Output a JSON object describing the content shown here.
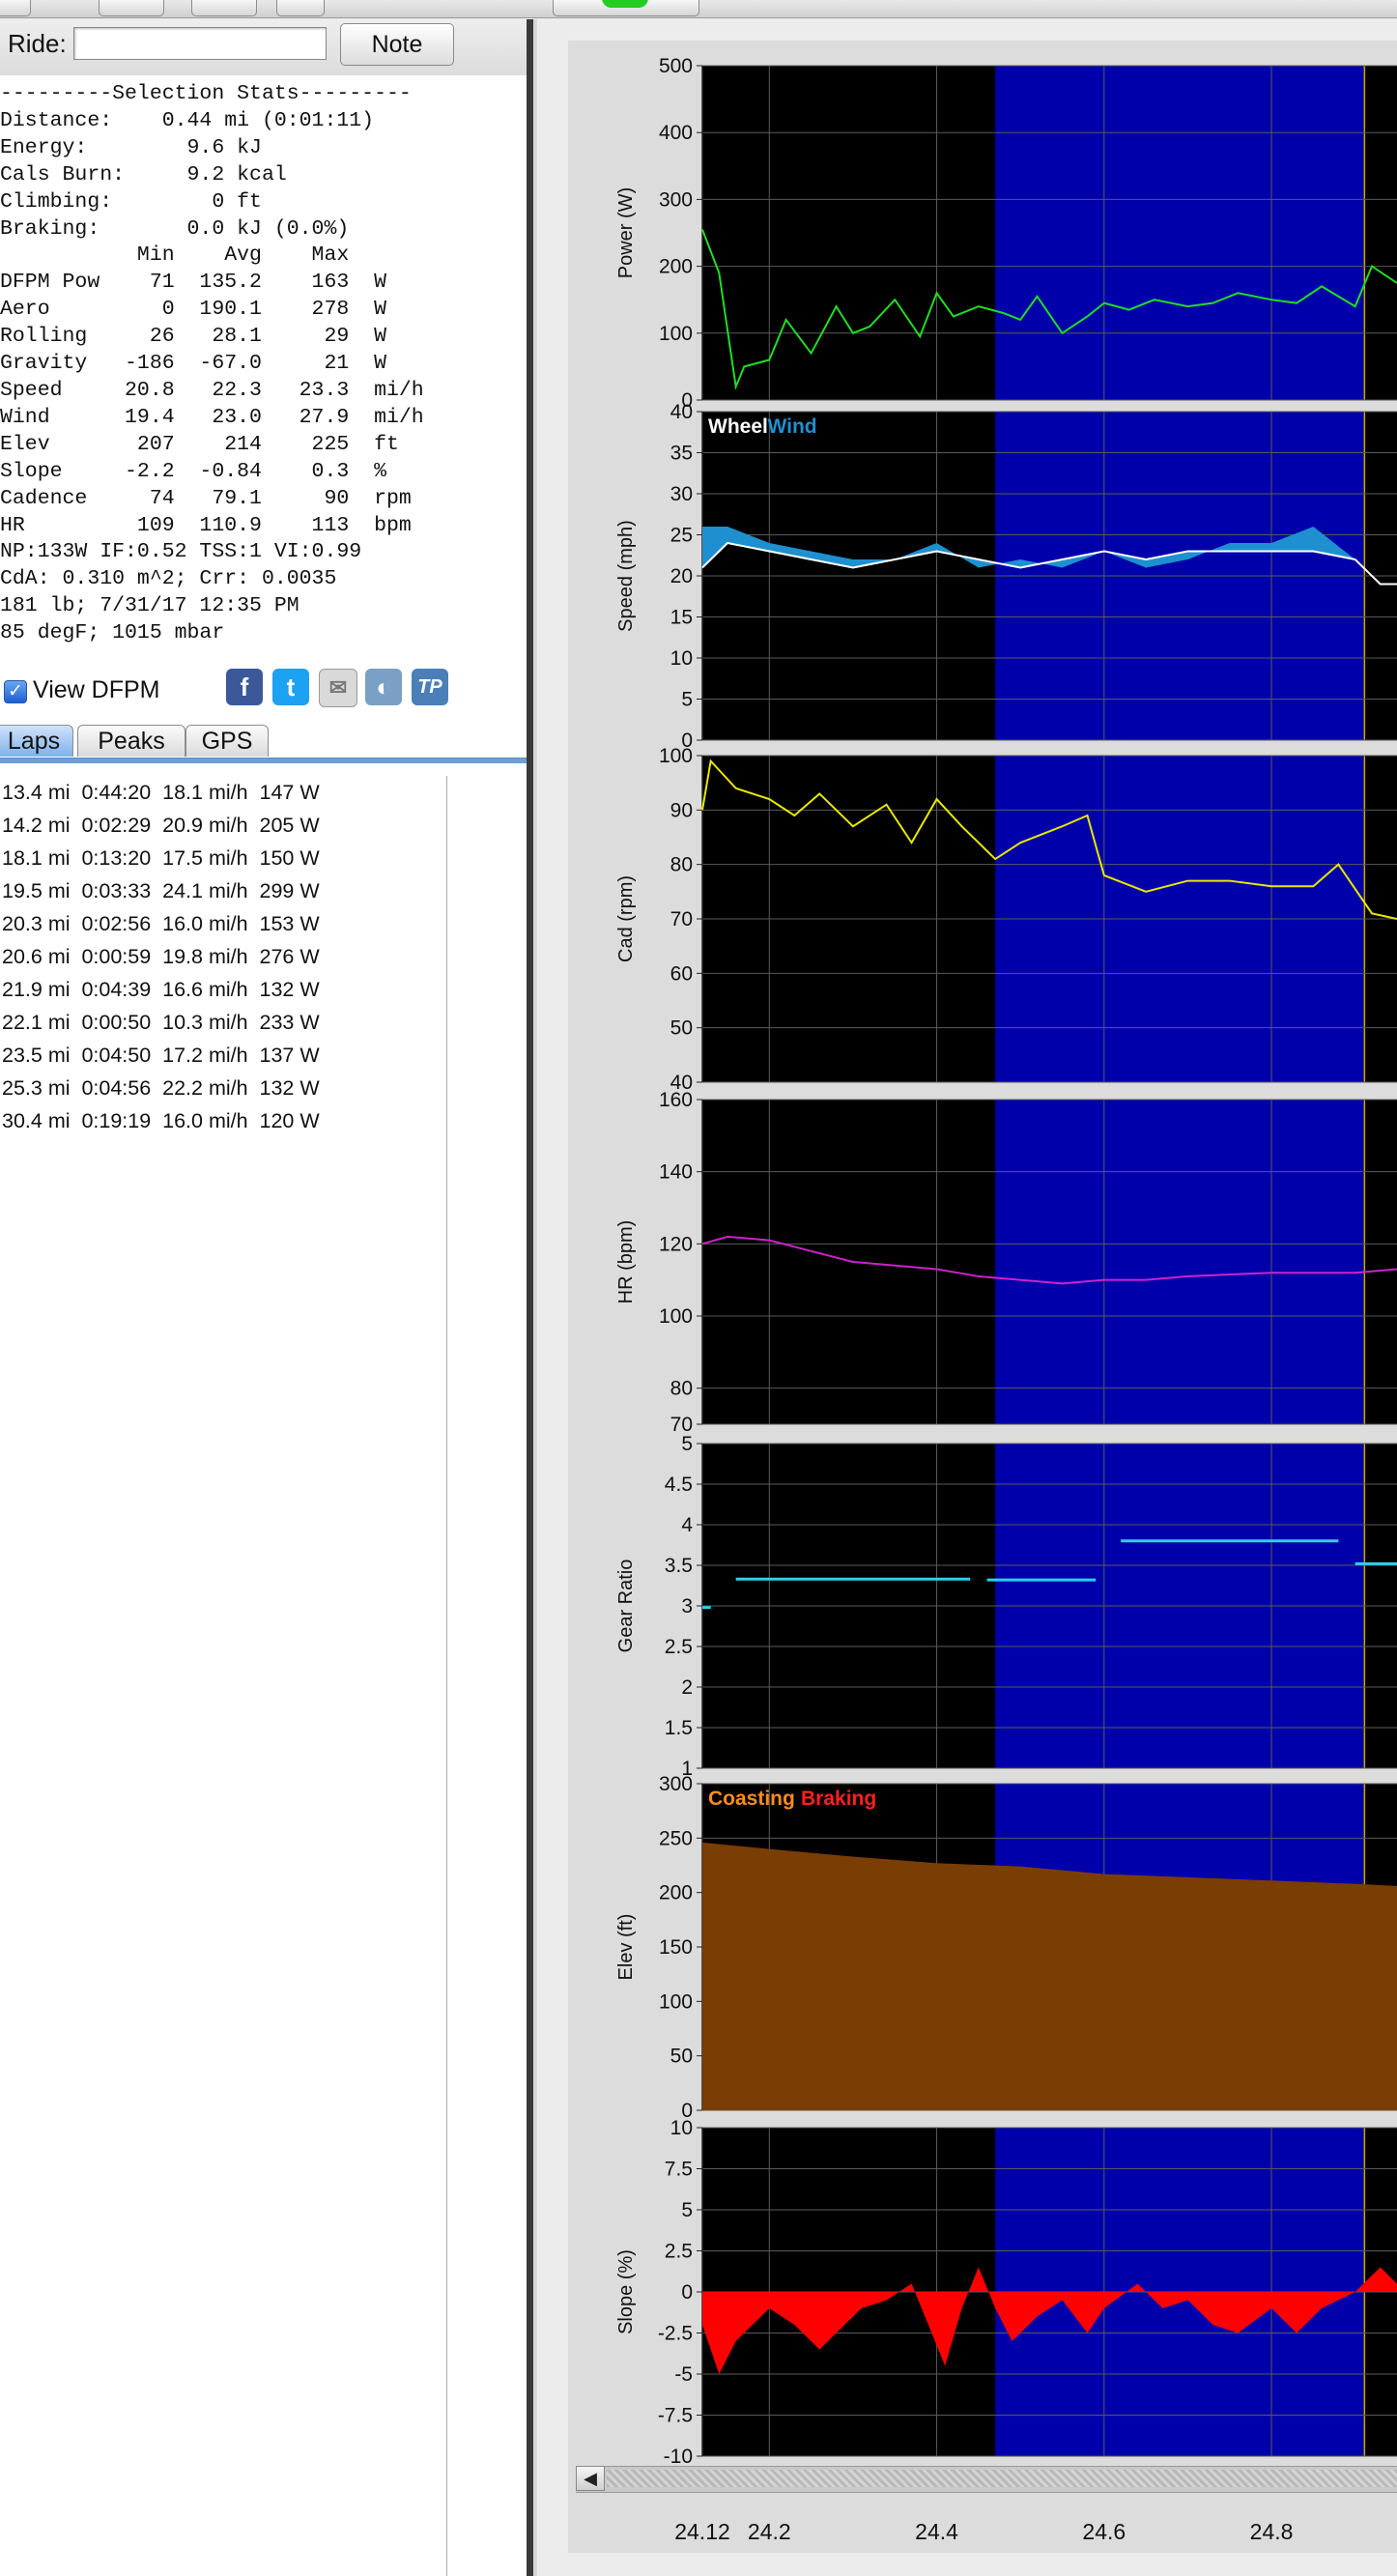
{
  "ride": {
    "label": "Ride:",
    "value": "",
    "note_button": "Note"
  },
  "stats_text": "---------Selection Stats---------\nDistance:    0.44 mi (0:01:11)\nEnergy:        9.6 kJ\nCals Burn:     9.2 kcal\nClimbing:        0 ft\nBraking:       0.0 kJ (0.0%)\n           Min    Avg    Max\nDFPM Pow    71  135.2    163  W\nAero         0  190.1    278  W\nRolling     26   28.1     29  W\nGravity   -186  -67.0     21  W\nSpeed     20.8   22.3   23.3  mi/h\nWind      19.4   23.0   27.9  mi/h\nElev       207    214    225  ft\nSlope     -2.2  -0.84    0.3  %\nCadence     74   79.1     90  rpm\nHR         109  110.9    113  bpm\nNP:133W IF:0.52 TSS:1 VI:0.99\nCdA: 0.310 m^2; Crr: 0.0035\n181 lb; 7/31/17 12:35 PM\n85 degF; 1015 mbar",
  "view_dfpm": {
    "label": "View DFPM",
    "checked": true
  },
  "share_icons": [
    "facebook-icon",
    "twitter-icon",
    "email-icon",
    "globe-icon",
    "trainingpeaks-icon"
  ],
  "tabs": [
    "Laps",
    "Peaks",
    "GPS"
  ],
  "active_tab": "Laps",
  "laps": [
    "13.4 mi  0:44:20  18.1 mi/h  147 W",
    "14.2 mi  0:02:29  20.9 mi/h  205 W",
    "18.1 mi  0:13:20  17.5 mi/h  150 W",
    "19.5 mi  0:03:33  24.1 mi/h  299 W",
    "20.3 mi  0:02:56  16.0 mi/h  153 W",
    "20.6 mi  0:00:59  19.8 mi/h  276 W",
    "21.9 mi  0:04:39  16.6 mi/h  132 W",
    "22.1 mi  0:00:50  10.3 mi/h  233 W",
    "23.5 mi  0:04:50  17.2 mi/h  137 W",
    "25.3 mi  0:04:56  22.2 mi/h  132 W",
    "30.4 mi  0:19:19  16.0 mi/h  120 W"
  ],
  "colors": {
    "plot_bg": "#000000",
    "selection": "#0000aa",
    "grid": "#5a5a5a",
    "power": "#22dd22",
    "speed": "#ffffff",
    "wind": "#1e90d0",
    "cadence": "#e8e800",
    "hr": "#cc22cc",
    "gear": "#33ccee",
    "elev": "#7a3d04",
    "slope": "#ff0000",
    "coasting": "#ff8c1a",
    "braking": "#ff2020"
  },
  "chart_data": {
    "type": "line",
    "x_axis": {
      "label": "",
      "range": [
        24.12,
        24.95
      ],
      "ticks": [
        "24.12",
        "24.2",
        "24.4",
        "24.6",
        "24.8"
      ]
    },
    "selection": [
      24.47,
      24.91
    ],
    "panels": [
      {
        "name": "power",
        "ylabel": "Power (W)",
        "ylim": [
          0,
          500
        ],
        "ticks": [
          "0",
          "100",
          "200",
          "300",
          "400",
          "500"
        ],
        "x": [
          24.12,
          24.14,
          24.16,
          24.17,
          24.2,
          24.22,
          24.25,
          24.28,
          24.3,
          24.32,
          24.35,
          24.38,
          24.4,
          24.42,
          24.45,
          24.48,
          24.5,
          24.52,
          24.55,
          24.58,
          24.6,
          24.63,
          24.66,
          24.7,
          24.73,
          24.76,
          24.8,
          24.83,
          24.86,
          24.9,
          24.92,
          24.95
        ],
        "y": [
          255,
          190,
          20,
          50,
          60,
          120,
          70,
          140,
          100,
          110,
          150,
          95,
          160,
          125,
          140,
          130,
          120,
          155,
          100,
          125,
          145,
          135,
          150,
          140,
          145,
          160,
          150,
          145,
          170,
          140,
          200,
          175
        ]
      },
      {
        "name": "speed",
        "ylabel": "Speed (mph)",
        "ylim": [
          0,
          40
        ],
        "ticks": [
          "0",
          "5",
          "10",
          "15",
          "20",
          "25",
          "30",
          "35",
          "40"
        ],
        "legend": [
          "Wheel",
          "Wind"
        ],
        "x": [
          24.12,
          24.15,
          24.2,
          24.25,
          24.3,
          24.35,
          24.4,
          24.45,
          24.5,
          24.55,
          24.6,
          24.65,
          24.7,
          24.75,
          24.8,
          24.85,
          24.9,
          24.93,
          24.95
        ],
        "y": [
          21,
          24,
          23,
          22,
          21,
          22,
          23,
          22,
          21,
          22,
          23,
          22,
          23,
          23,
          23,
          23,
          22,
          19,
          19
        ],
        "wind": [
          26,
          26,
          24,
          23,
          22,
          22,
          24,
          21,
          22,
          21,
          23,
          21,
          22,
          24,
          24,
          26,
          22,
          19,
          19
        ]
      },
      {
        "name": "cadence",
        "ylabel": "Cad (rpm)",
        "ylim": [
          40,
          100
        ],
        "ticks": [
          "40",
          "50",
          "60",
          "70",
          "80",
          "90",
          "100"
        ],
        "x": [
          24.12,
          24.13,
          24.16,
          24.2,
          24.23,
          24.26,
          24.3,
          24.34,
          24.37,
          24.4,
          24.43,
          24.47,
          24.5,
          24.55,
          24.58,
          24.6,
          24.65,
          24.7,
          24.75,
          24.8,
          24.85,
          24.88,
          24.92,
          24.95
        ],
        "y": [
          90,
          99,
          94,
          92,
          89,
          93,
          87,
          91,
          84,
          92,
          87,
          81,
          84,
          87,
          89,
          78,
          75,
          77,
          77,
          76,
          76,
          80,
          71,
          70
        ]
      },
      {
        "name": "hr",
        "ylabel": "HR (bpm)",
        "ylim": [
          70,
          160
        ],
        "ticks": [
          "70",
          "80",
          "100",
          "120",
          "140",
          "160"
        ],
        "x": [
          24.12,
          24.15,
          24.2,
          24.25,
          24.3,
          24.35,
          24.4,
          24.45,
          24.5,
          24.55,
          24.6,
          24.65,
          24.7,
          24.8,
          24.9,
          24.95
        ],
        "y": [
          120,
          122,
          121,
          118,
          115,
          114,
          113,
          111,
          110,
          109,
          110,
          110,
          111,
          112,
          112,
          113
        ]
      },
      {
        "name": "gear",
        "ylabel": "Gear Ratio",
        "ylim": [
          1,
          5
        ],
        "ticks": [
          "1",
          "1.5",
          "2",
          "2.5",
          "3",
          "3.5",
          "4",
          "4.5",
          "5"
        ],
        "segments": [
          [
            24.12,
            24.13,
            2.98
          ],
          [
            24.16,
            24.44,
            3.33
          ],
          [
            24.46,
            24.59,
            3.32
          ],
          [
            24.62,
            24.88,
            3.8
          ],
          [
            24.9,
            24.95,
            3.52
          ]
        ]
      },
      {
        "name": "elev",
        "ylabel": "Elev (ft)",
        "ylim": [
          0,
          300
        ],
        "ticks": [
          "0",
          "50",
          "100",
          "150",
          "200",
          "250",
          "300"
        ],
        "legend": [
          "Coasting",
          "Braking"
        ],
        "x": [
          24.12,
          24.2,
          24.3,
          24.4,
          24.5,
          24.6,
          24.7,
          24.8,
          24.9,
          24.95
        ],
        "y": [
          246,
          240,
          233,
          227,
          224,
          217,
          214,
          211,
          208,
          206
        ]
      },
      {
        "name": "slope",
        "ylabel": "Slope (%)",
        "ylim": [
          -10,
          10
        ],
        "ticks": [
          "-10",
          "-7.5",
          "-5",
          "-2.5",
          "0",
          "2.5",
          "5",
          "7.5",
          "10"
        ],
        "x": [
          24.12,
          24.14,
          24.16,
          24.18,
          24.2,
          24.23,
          24.26,
          24.29,
          24.31,
          24.34,
          24.37,
          24.39,
          24.41,
          24.43,
          24.45,
          24.47,
          24.49,
          24.52,
          24.55,
          24.58,
          24.6,
          24.64,
          24.67,
          24.7,
          24.73,
          24.76,
          24.8,
          24.83,
          24.86,
          24.9,
          24.93,
          24.95
        ],
        "y": [
          -2,
          -5,
          -3,
          -2,
          -1,
          -2,
          -3.5,
          -2,
          -1,
          -0.5,
          0.5,
          -2,
          -4.5,
          -1,
          1.5,
          -1,
          -3,
          -1.5,
          -0.5,
          -2.5,
          -1,
          0.5,
          -1,
          -0.5,
          -2,
          -2.5,
          -1,
          -2.5,
          -1,
          0,
          1.5,
          0.5
        ]
      }
    ]
  }
}
